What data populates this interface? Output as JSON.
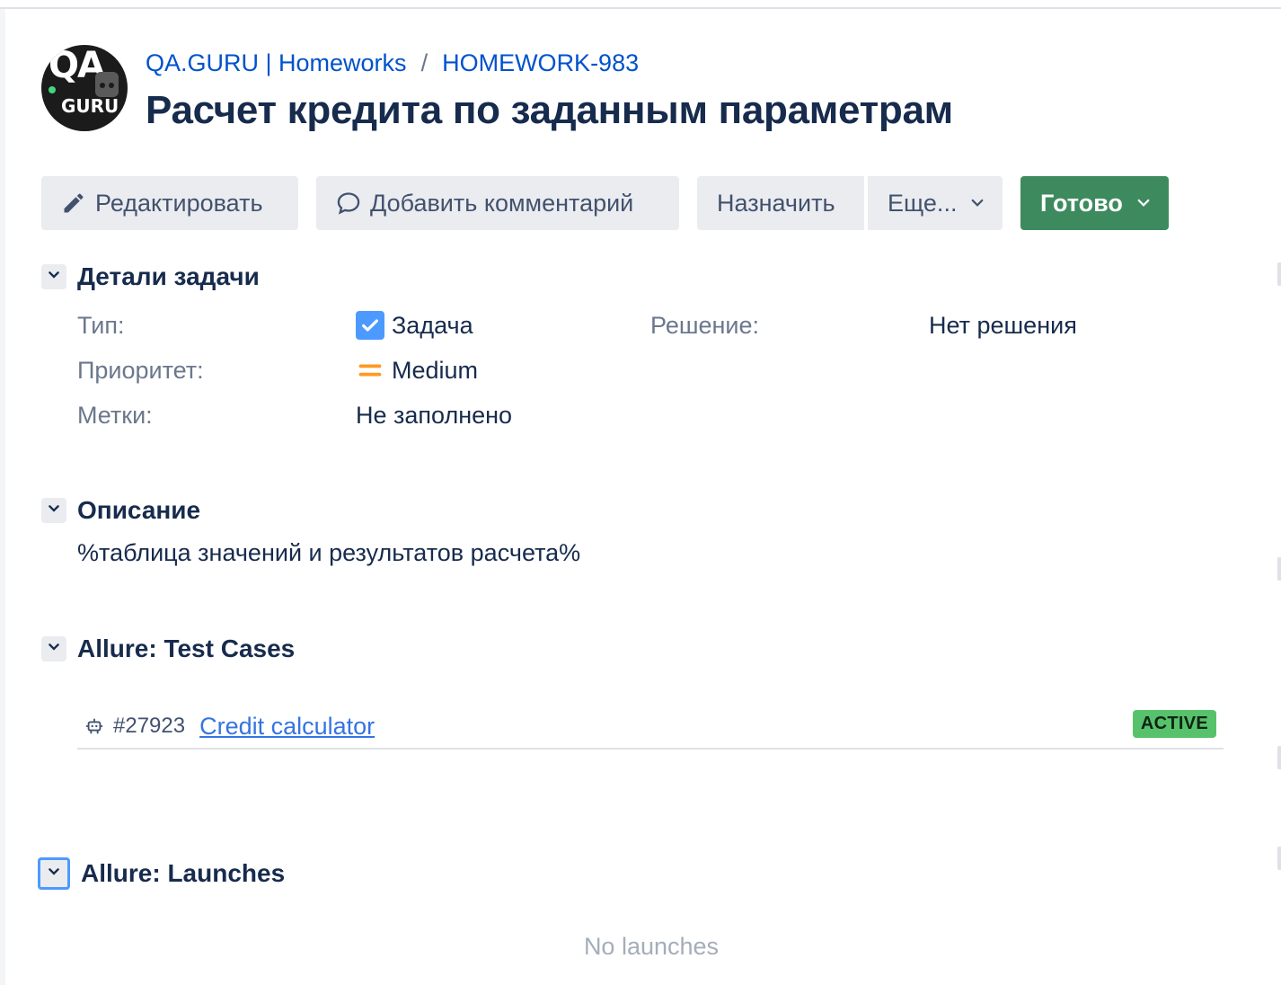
{
  "breadcrumb": {
    "project": "QA.GURU | Homeworks",
    "separator": "/",
    "issue_key": "HOMEWORK-983"
  },
  "avatar": {
    "text_top": "QA",
    "text_bottom": "GURU"
  },
  "issue_title": "Расчет кредита по заданным параметрам",
  "toolbar": {
    "edit_label": "Редактировать",
    "comment_label": "Добавить комментарий",
    "assign_label": "Назначить",
    "more_label": "Еще...",
    "status_label": "Готово",
    "status_color": "#3d8a5f"
  },
  "details": {
    "section_title": "Детали задачи",
    "type_label": "Тип:",
    "type_value": "Задача",
    "priority_label": "Приоритет:",
    "priority_value": "Medium",
    "labels_label": "Метки:",
    "labels_value": "Не заполнено",
    "resolution_label": "Решение:",
    "resolution_value": "Нет решения"
  },
  "description": {
    "section_title": "Описание",
    "text": "%таблица значений и результатов расчета%"
  },
  "test_cases": {
    "section_title": "Allure: Test Cases",
    "items": [
      {
        "id": "#27923",
        "name": "Credit calculator",
        "status": "ACTIVE",
        "status_color": "#57c26b"
      }
    ]
  },
  "launches": {
    "section_title": "Allure: Launches",
    "empty_text": "No launches"
  },
  "icons": {
    "edit": "pencil-icon",
    "comment": "comment-icon",
    "chevron": "chevron-down-icon",
    "type": "checkbox-task-icon",
    "priority": "priority-medium-icon",
    "test_case": "robot-icon"
  }
}
